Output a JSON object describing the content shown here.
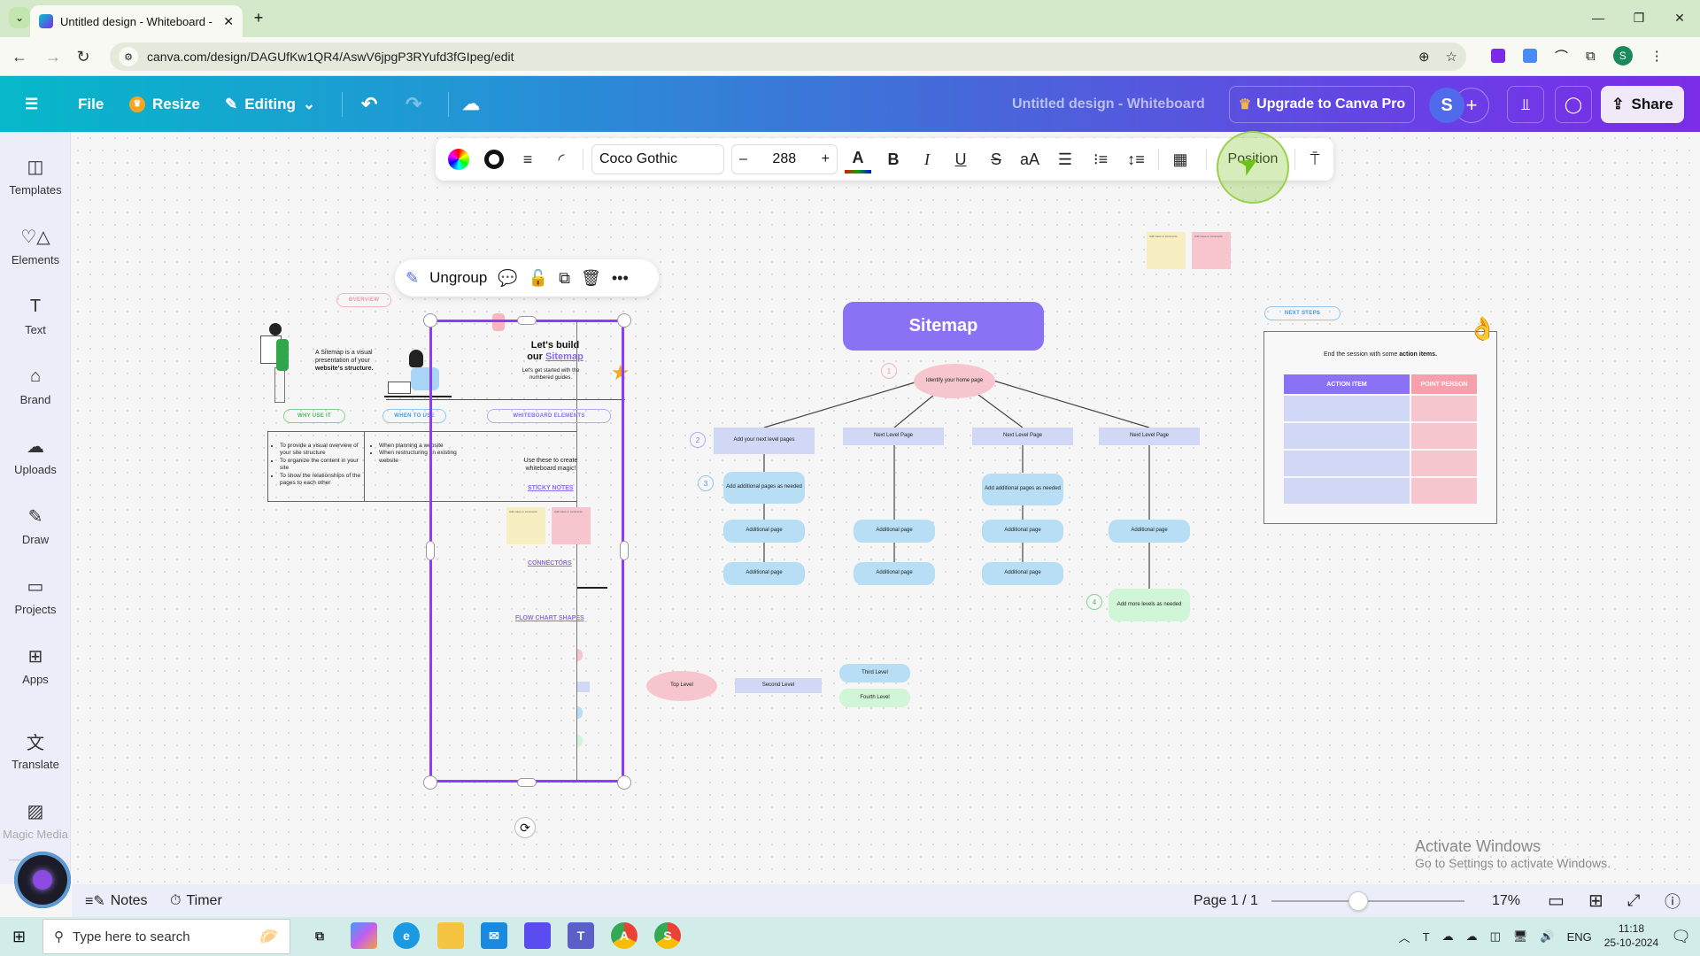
{
  "browser": {
    "tab_title": "Untitled design - Whiteboard - ",
    "url": "canva.com/design/DAGUfKw1QR4/AswV6jpgP3RYufd3fGIpeg/edit",
    "profile_initial": "S"
  },
  "header": {
    "file": "File",
    "resize": "Resize",
    "editing": "Editing",
    "doc_title": "Untitled design - Whiteboard",
    "upgrade": "Upgrade to Canva Pro",
    "user_initial": "S",
    "share": "Share"
  },
  "sidebar": {
    "items": [
      {
        "label": "Templates",
        "icon": "templates-icon"
      },
      {
        "label": "Elements",
        "icon": "elements-icon"
      },
      {
        "label": "Text",
        "icon": "text-icon"
      },
      {
        "label": "Brand",
        "icon": "brand-icon"
      },
      {
        "label": "Uploads",
        "icon": "uploads-icon"
      },
      {
        "label": "Draw",
        "icon": "draw-icon"
      },
      {
        "label": "Projects",
        "icon": "projects-icon"
      },
      {
        "label": "Apps",
        "icon": "apps-icon"
      },
      {
        "label": "Translate",
        "icon": "translate-icon"
      },
      {
        "label": "Magic Media",
        "icon": "magic-media-icon"
      }
    ]
  },
  "toolbar": {
    "font": "Coco Gothic",
    "font_size": "288",
    "minus": "–",
    "plus": "+",
    "position": "Position"
  },
  "context_menu": {
    "ungroup": "Ungroup"
  },
  "board": {
    "overview_pill": "OVERVIEW",
    "intro_text_1": "A Sitemap is a visual presentation of your",
    "intro_text_2": "website's structure.",
    "lets_build_1": "Let's build",
    "lets_build_2": "our",
    "lets_build_link": "Sitemap",
    "get_started": "Let's get started with the numbered guides.",
    "why_pill": "WHY USE IT",
    "when_pill": "WHEN TO USE",
    "elements_pill": "WHITEBOARD ELEMENTS",
    "why_items": [
      "To provide a visual overview of your site structure",
      "To organize the content in your site",
      "To show the relationships of the pages to each other"
    ],
    "when_items": [
      "When planning a website",
      "When restructuring an existing website"
    ],
    "elements_intro": "Use these to create whiteboard magic!",
    "sticky_notes_link": "STICKY NOTES",
    "sticky_text": "Add notes or comments",
    "connectors_link": "CONNECTORS",
    "flow_link": "FLOW CHART SHAPES",
    "sitemap_title": "Sitemap",
    "home_node": "Identify your home page",
    "level2": [
      "Add your next level pages",
      "Next Level Page",
      "Next Level Page",
      "Next Level Page"
    ],
    "level3_add": "Add additional pages as needed",
    "additional_page": "Additional page",
    "more_levels": "Add more levels as needed",
    "step_numbers": [
      "1",
      "2",
      "3",
      "4"
    ],
    "legend": [
      "Top Level",
      "Second Level",
      "Third Level",
      "Fourth Level"
    ],
    "next_steps_pill": "NEXT STEPS",
    "next_steps_text_1": "End the session with some",
    "next_steps_text_2": "action items.",
    "table_headers": [
      "ACTION ITEM",
      "POINT PERSON"
    ],
    "table_rows": 4
  },
  "bottom": {
    "notes": "Notes",
    "timer": "Timer",
    "page": "Page 1 / 1",
    "zoom": "17%",
    "zoom_fraction": 0.45
  },
  "watermark": {
    "line1": "Activate Windows",
    "line2": "Go to Settings to activate Windows."
  },
  "taskbar": {
    "search_placeholder": "Type here to search",
    "lang": "ENG",
    "time": "11:18",
    "date": "25-10-2024"
  },
  "colors": {
    "selection": "#8b3dff",
    "sitemap_purple": "#8b72f5",
    "pink": "#f7c5cd",
    "lavender": "#d0d8f5",
    "blue": "#b8def5",
    "green": "#d1f5d7",
    "yellow": "#f7efc2"
  }
}
